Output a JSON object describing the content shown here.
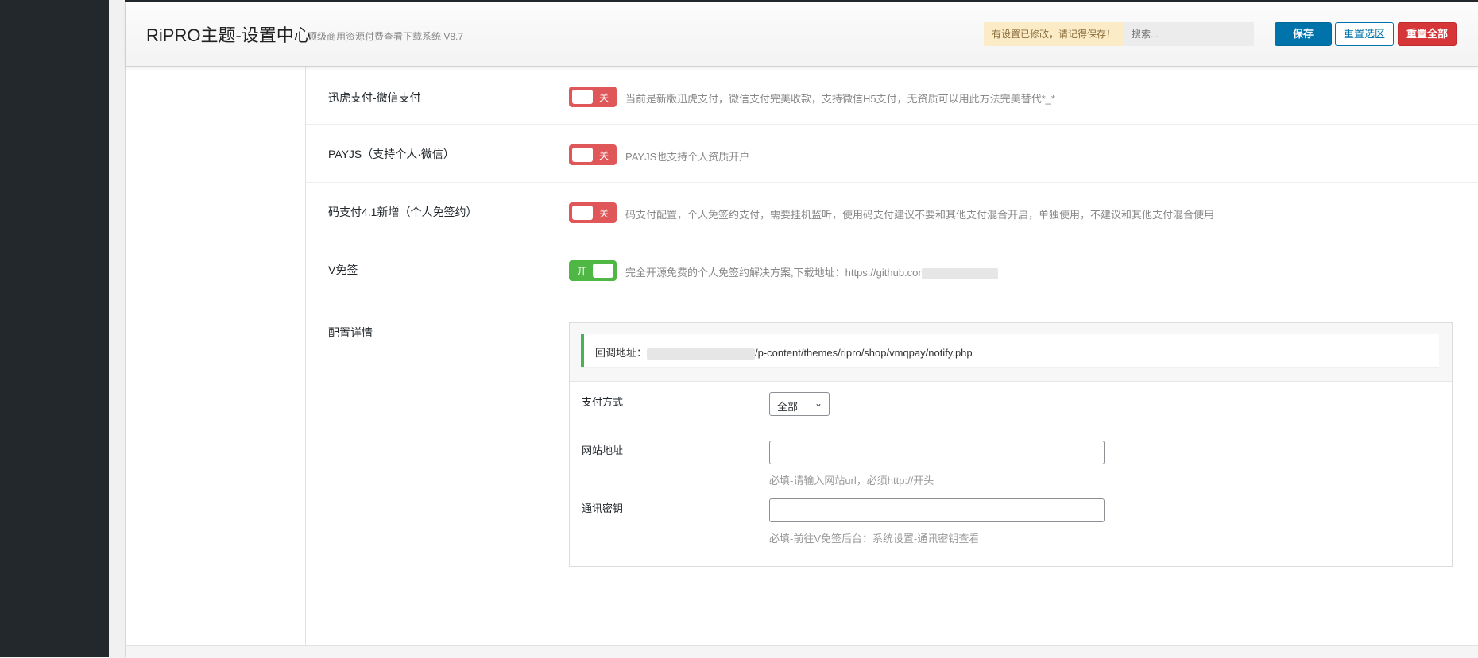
{
  "header": {
    "brand": "RiPRO主题-设置中心",
    "version": "顶级商用资源付费查看下载系统 V8.7",
    "unsaved_notice": "有设置已修改，请记得保存！",
    "search_placeholder": "搜索...",
    "save_label": "保存",
    "reset_section_label": "重置选区",
    "reset_all_label": "重置全部"
  },
  "fields": [
    {
      "label": "迅虎支付-微信支付",
      "switch_text": "关",
      "switch_on": false,
      "desc": "当前是新版迅虎支付，微信支付完美收款，支持微信H5支付，无资质可以用此方法完美替代*_*"
    },
    {
      "label": "PAYJS（支持个人·微信）",
      "switch_text": "关",
      "switch_on": false,
      "desc": "PAYJS也支持个人资质开户"
    },
    {
      "label": "码支付4.1新增（个人免签约）",
      "switch_text": "关",
      "switch_on": false,
      "desc": "码支付配置，个人免签约支付，需要挂机监听，使用码支付建议不要和其他支付混合开启，单独使用，不建议和其他支付混合使用"
    },
    {
      "label": "V免签",
      "switch_text": "开",
      "switch_on": true,
      "desc": "完全开源免费的个人免签约解决方案,下载地址：https://github.cor"
    }
  ],
  "config": {
    "label": "配置详情",
    "notice_prefix": "回调地址：",
    "notice_suffix": "/p-content/themes/ripro/shop/vmqpay/notify.php",
    "pay_method_label": "支付方式",
    "pay_method_value": "全部",
    "site_url_label": "网站地址",
    "site_url_help": "必填-请输入网站url，必须http://开头",
    "key_label": "通讯密钥",
    "key_help": "必填-前往V免签后台：系统设置-通讯密钥查看"
  },
  "colors": {
    "primary": "#0073aa",
    "danger": "#d63638",
    "switch_off": "#e0575a",
    "switch_on": "#4fb845",
    "notice_border": "#46b450"
  }
}
